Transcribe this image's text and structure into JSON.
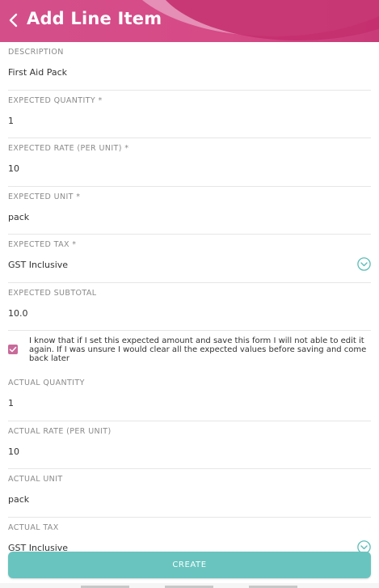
{
  "header": {
    "title": "Add Line Item",
    "back_icon": "chevron-left-icon"
  },
  "fields": [
    {
      "label": "DESCRIPTION",
      "value": "First Aid Pack"
    },
    {
      "label": "EXPECTED QUANTITY *",
      "value": "1"
    },
    {
      "label": "EXPECTED RATE (PER UNIT) *",
      "value": "10"
    },
    {
      "label": "EXPECTED UNIT *",
      "value": "pack"
    },
    {
      "label": "EXPECTED TAX *",
      "value": "GST Inclusive"
    },
    {
      "label": "EXPECTED SUBTOTAL",
      "value": "10.0"
    }
  ],
  "confirm": {
    "checked": true,
    "text": "I know that if I set this expected amount and save this form I will not able to edit it again. If I was unsure I would clear all the expected values before saving and come back later"
  },
  "actual_fields": [
    {
      "label": "ACTUAL QUANTITY",
      "value": "1"
    },
    {
      "label": "ACTUAL RATE (PER UNIT)",
      "value": "10"
    },
    {
      "label": "ACTUAL UNIT",
      "value": "pack"
    },
    {
      "label": "ACTUAL TAX",
      "value": "GST Inclusive"
    }
  ],
  "create_label": "CREATE",
  "colors": {
    "header": "#d44f8a",
    "accent": "#69c4bf",
    "checkbox": "#c96a9a"
  }
}
